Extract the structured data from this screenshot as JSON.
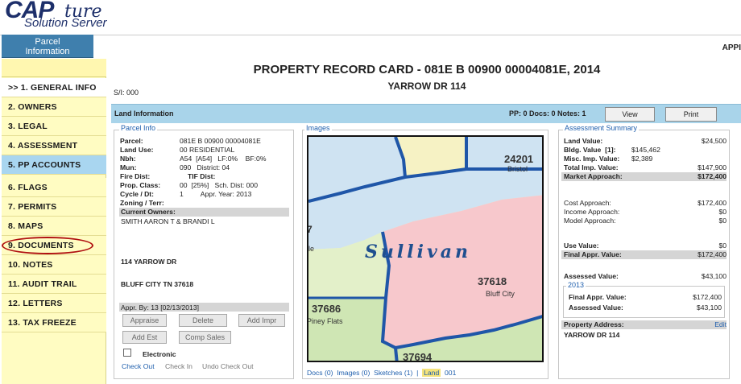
{
  "logo": {
    "brand": "CAPture",
    "cap": "CAP",
    "ture": "ture",
    "sub": "Solution Server"
  },
  "topbar": {
    "tab_line1": "Parcel",
    "tab_line2": "Information",
    "right_label": "APPI"
  },
  "sidebar": {
    "items": [
      {
        "label": ">> 1. GENERAL INFO",
        "state": "active"
      },
      {
        "label": "2. OWNERS"
      },
      {
        "label": "3. LEGAL"
      },
      {
        "label": "4. ASSESSMENT"
      },
      {
        "label": "5. PP ACCOUNTS",
        "state": "highlight"
      },
      {
        "label": "6. FLAGS"
      },
      {
        "label": "7. PERMITS"
      },
      {
        "label": "8. MAPS"
      },
      {
        "label": "9. DOCUMENTS",
        "state": "circled"
      },
      {
        "label": "10. NOTES"
      },
      {
        "label": "11. AUDIT TRAIL"
      },
      {
        "label": "12. LETTERS"
      },
      {
        "label": "13. TAX FREEZE"
      }
    ]
  },
  "header": {
    "title": "PROPERTY RECORD CARD - 081E B 00900 00004081E, 2014",
    "address": "YARROW DR 114",
    "sl": "S/I: 000"
  },
  "landbar": {
    "label": "Land Information",
    "counts": "PP: 0   Docs: 0   Notes: 1",
    "view": "View",
    "print": "Print"
  },
  "parcel": {
    "title": "Parcel Info",
    "parcel_label": "Parcel:",
    "parcel_value": "081E B 00900 00004081E",
    "landuse_label": "Land Use:",
    "landuse_value": "00 RESIDENTIAL",
    "nbh_label": "Nbh:",
    "nbh_value": "A54  [A54]   LF:0%    BF:0%",
    "mun_label": "Mun:",
    "mun_value": "090   District: 04",
    "firedist_label": "Fire Dist:",
    "tifdist_label": "TIF Dist:",
    "propclass_label": "Prop. Class:",
    "propclass_value": "00  [25%]   Sch. Dist: 000",
    "cycle_label": "Cycle / Dt:",
    "cycle_value": "1         Appr. Year: 2013",
    "zoning_label": "Zoning / Terr:",
    "owners_label": "Current Owners:",
    "owner": "SMITH AARON T & BRANDI L",
    "street": "114 YARROW DR",
    "city": "BLUFF CITY TN 37618",
    "appr_by": "Appr. By: 13 [02/13/2013]",
    "btn_appraise": "Appraise",
    "btn_delete": "Delete",
    "btn_addimpr": "Add Impr",
    "btn_addest": "Add Est",
    "btn_compsales": "Comp Sales",
    "electronic": "Electronic",
    "checkout": "Check Out",
    "checkin": "Check In",
    "undo": "Undo Check Out"
  },
  "images": {
    "title": "Images",
    "map_labels": {
      "z1": "24201",
      "z1b": "Bristol",
      "county": "Sullivan",
      "z2": "37618",
      "z2b": "Bluff City",
      "z3": "37686",
      "z3b": "Piney Flats",
      "z4": "37694",
      "mile": "7",
      "ile": "ile"
    },
    "links_pre": "Docs (0)  Images (0)  Sketches (1)  |  ",
    "land_link": "Land",
    "land_num": "  001",
    "colors": {
      "blue_zone": "#cfe3f2",
      "pink_zone": "#f7c8cc",
      "green_zone": "#cfe6b4",
      "yellow_zone": "#f6f2c4",
      "border": "#1f56a8"
    }
  },
  "assessment": {
    "title": "Assessment Summary",
    "land_value_label": "Land Value:",
    "land_value": "$24,500",
    "bldg_label": "Bldg. Value  [1]:",
    "bldg_value": "$145,462",
    "misc_label": "Misc. Imp. Value:",
    "misc_value": "$2,389",
    "total_label": "Total Imp. Value:",
    "total_value": "$147,900",
    "market_label": "Market Approach:",
    "market_value": "$172,400",
    "cost_label": "Cost Approach:",
    "cost_value": "$172,400",
    "income_label": "Income Approach:",
    "income_value": "$0",
    "model_label": "Model Approach:",
    "model_value": "$0",
    "use_label": "Use Value:",
    "use_value": "$0",
    "final_label": "Final Appr. Value:",
    "final_value": "$172,400",
    "assessed_label": "Assessed Value:",
    "assessed_value": "$43,100",
    "year": "2013",
    "y_final_label": "Final Appr. Value:",
    "y_final_value": "$172,400",
    "y_assessed_label": "Assessed Value:",
    "y_assessed_value": "$43,100",
    "prop_addr_label": "Property Address:",
    "edit": "Edit",
    "prop_addr": "YARROW DR 114"
  }
}
